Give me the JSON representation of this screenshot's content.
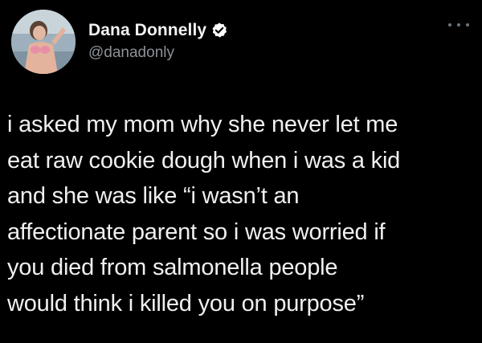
{
  "tweet": {
    "author": {
      "display_name": "Dana Donnelly",
      "handle": "@danadonly",
      "verified": true,
      "avatar_icon": "profile-photo"
    },
    "more_icon": "ellipsis-icon",
    "text_lines": [
      "i asked my mom why she never let me",
      "eat raw cookie dough when i was a kid",
      "and she was like “i wasn’t an",
      "affectionate parent so i was worried if",
      "you died from salmonella people",
      "would think i killed you on purpose”"
    ]
  },
  "colors": {
    "background": "#000000",
    "text": "#f0f0f0",
    "handle": "#8b9298",
    "verified_badge": "#ffffff"
  }
}
